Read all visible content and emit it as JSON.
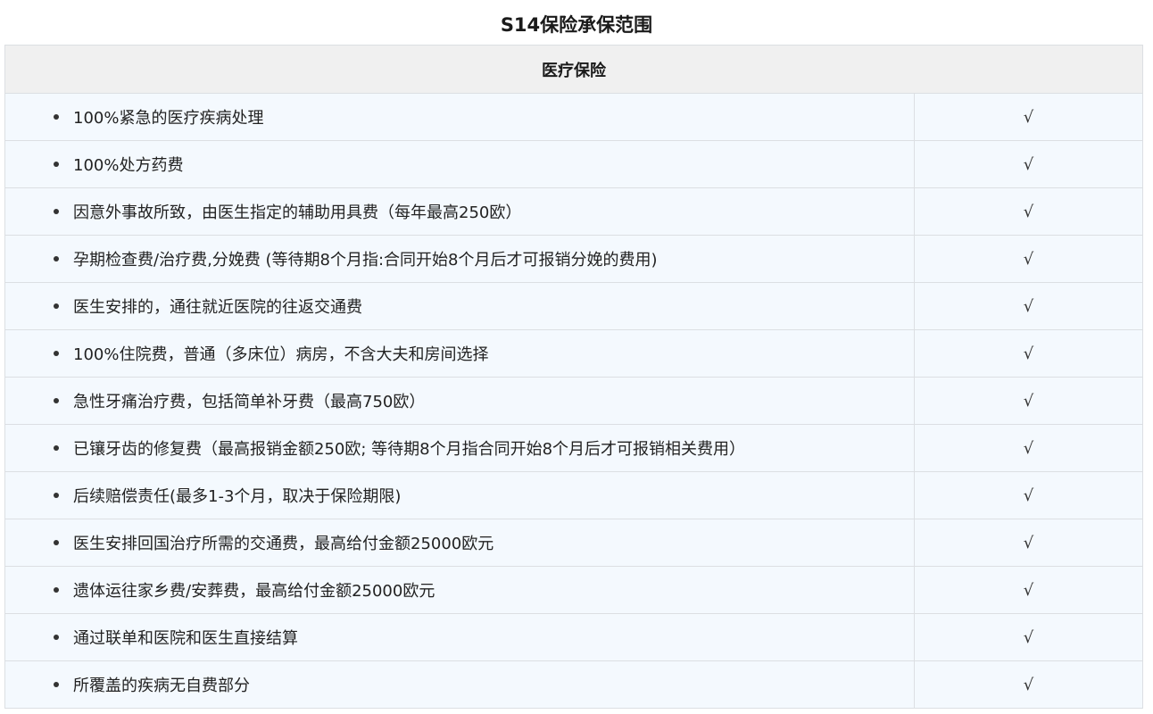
{
  "title": "S14保险承保范围",
  "section": {
    "header": "医疗保险"
  },
  "rows": [
    {
      "item": "100%紧急的医疗疾病处理",
      "mark": "√"
    },
    {
      "item": "100%处方药费",
      "mark": "√"
    },
    {
      "item": "因意外事故所致，由医生指定的辅助用具费（每年最高250欧）",
      "mark": "√"
    },
    {
      "item": "孕期检查费/治疗费,分娩费 (等待期8个月指:合同开始8个月后才可报销分娩的费用)",
      "mark": "√"
    },
    {
      "item": "医生安排的，通往就近医院的往返交通费",
      "mark": "√"
    },
    {
      "item": "100%住院费，普通（多床位）病房，不含大夫和房间选择",
      "mark": "√"
    },
    {
      "item": "急性牙痛治疗费，包括简单补牙费（最高750欧）",
      "mark": "√"
    },
    {
      "item": "已镶牙齿的修复费（最高报销金额250欧; 等待期8个月指合同开始8个月后才可报销相关费用）",
      "mark": "√"
    },
    {
      "item": "后续赔偿责任(最多1-3个月，取决于保险期限)",
      "mark": "√"
    },
    {
      "item": "医生安排回国治疗所需的交通费，最高给付金额25000欧元",
      "mark": "√"
    },
    {
      "item": "遗体运往家乡费/安葬费，最高给付金额25000欧元",
      "mark": "√"
    },
    {
      "item": "通过联单和医院和医生直接结算",
      "mark": "√"
    },
    {
      "item": "所覆盖的疾病无自费部分",
      "mark": "√"
    }
  ]
}
